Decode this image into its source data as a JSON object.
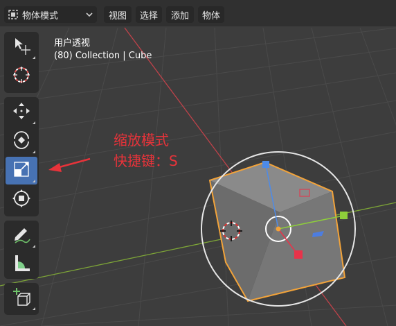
{
  "header": {
    "mode_icon": "object-mode-icon",
    "mode_label": "物体模式",
    "menus": [
      "视图",
      "选择",
      "添加",
      "物体"
    ]
  },
  "viewport": {
    "view_name": "用户透视",
    "collection_info": "(80) Collection | Cube"
  },
  "toolbar": {
    "tools": [
      {
        "name": "select-tool",
        "icon": "cursor-select-icon"
      },
      {
        "name": "cursor-tool",
        "icon": "3d-cursor-icon"
      },
      {
        "name": "move-tool",
        "icon": "move-icon"
      },
      {
        "name": "rotate-tool",
        "icon": "rotate-icon"
      },
      {
        "name": "scale-tool",
        "icon": "scale-icon",
        "active": true
      },
      {
        "name": "transform-tool",
        "icon": "transform-icon"
      },
      {
        "name": "annotate-tool",
        "icon": "annotate-icon"
      },
      {
        "name": "measure-tool",
        "icon": "measure-icon"
      },
      {
        "name": "add-cube-tool",
        "icon": "add-cube-icon"
      }
    ]
  },
  "annotation": {
    "line1": "缩放模式",
    "line2": "快捷键：S",
    "color": "#e8333a"
  },
  "colors": {
    "accent": "#4772b3",
    "selection_outline": "#f2a33a",
    "x_axis": "#c0424a",
    "y_axis": "#7ea637"
  }
}
